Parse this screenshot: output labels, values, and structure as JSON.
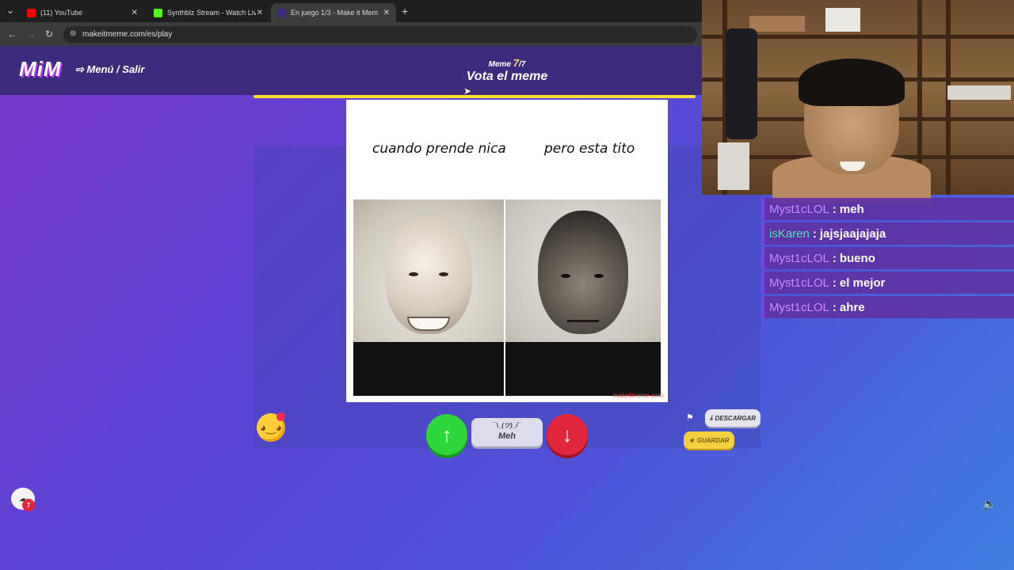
{
  "browser": {
    "tabs": [
      {
        "title": "(11) YouTube",
        "color": "#ff0000",
        "active": false
      },
      {
        "title": "Synthblz Stream - Watch Live o",
        "color": "#53fc18",
        "active": false
      },
      {
        "title": "En juego 1/3 - Make it Mem",
        "color": "#ffffff",
        "active": true
      }
    ],
    "new_tab": "+",
    "url": "makeitmeme.com/es/play"
  },
  "game": {
    "logo": "MiM",
    "menu_label": "⇨ Menú / Salir",
    "meme_prefix": "Meme",
    "meme_current": "7",
    "meme_total": "/7",
    "vote_title": "Vota el meme",
    "progress": 1.0,
    "meme": {
      "caption_left": "cuando prende nica",
      "caption_right": "pero esta tito",
      "watermark": "makeitmeme.com"
    },
    "meh_face": "¯\\_(ツ)_/¯",
    "meh_label": "Meh",
    "download_label": "DESCARGAR",
    "save_label": "GUARDAR",
    "chat_badge_count": "7",
    "accent_up": "#2ed63a",
    "accent_down": "#e2273d",
    "accent_progress": "#ffde2e"
  },
  "stream_chat": [
    {
      "user": "Myst1cLOL",
      "message": "meh",
      "color": "#c98cff"
    },
    {
      "user": "isKaren",
      "message": "jajsjaajajaja",
      "color": "#4fe3b0"
    },
    {
      "user": "Myst1cLOL",
      "message": "bueno",
      "color": "#c98cff"
    },
    {
      "user": "Myst1cLOL",
      "message": "el mejor",
      "color": "#c98cff"
    },
    {
      "user": "Myst1cLOL",
      "message": "ahre",
      "color": "#c98cff"
    }
  ],
  "icons": {
    "back": "←",
    "forward": "→",
    "reload": "↻",
    "site_info": "⊜",
    "tab_list": "⌄",
    "close": "✕",
    "up": "↑",
    "down": "↓",
    "flag": "⚑",
    "download": "⤓",
    "save": "★",
    "sound": "🔈",
    "emoji": "◕‿◕",
    "chat": "☁",
    "cursor": "➤"
  }
}
